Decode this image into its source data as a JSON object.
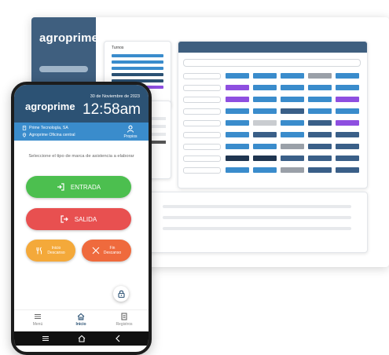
{
  "desktop": {
    "logo": "agroprime",
    "turnos_title": "Turnos",
    "turnos_lines": [
      "#3a8ccc",
      "#3a8ccc",
      "#3a8ccc",
      "#2c5274",
      "#2c5274",
      "#8e4fe0"
    ],
    "grid_rows": [
      [
        "#3a8ccc",
        "#3a8ccc",
        "#3a8ccc",
        "#9aa0a8",
        "#3a8ccc"
      ],
      [
        "#8e4fe0",
        "#3a8ccc",
        "#3a8ccc",
        "#3a8ccc",
        "#3a8ccc"
      ],
      [
        "#8e4fe0",
        "#3a8ccc",
        "#3a8ccc",
        "#3a8ccc",
        "#8e4fe0"
      ],
      [
        "#3a8ccc",
        "#3a8ccc",
        "#3a5f88",
        "#3a8ccc",
        "#3a8ccc"
      ],
      [
        "#3a8ccc",
        "#c9ccd0",
        "#3a8ccc",
        "#3a5f88",
        "#8e4fe0"
      ],
      [
        "#3a8ccc",
        "#3a5f88",
        "#3a8ccc",
        "#3a5f88",
        "#3a5f88"
      ],
      [
        "#3a8ccc",
        "#3a8ccc",
        "#9aa0a8",
        "#3a5f88",
        "#3a5f88"
      ],
      [
        "#1f3550",
        "#1f3550",
        "#3a5f88",
        "#3a5f88",
        "#3a5f88"
      ],
      [
        "#3a8ccc",
        "#3a8ccc",
        "#9aa0a8",
        "#3a5f88",
        "#3a5f88"
      ]
    ]
  },
  "phone": {
    "logo": "agroprime",
    "date": "30 de Noviembre de 2023",
    "time": "12:58am",
    "company": "Prime Tecnología, SA",
    "office": "Agroprime Oficina central",
    "propios_label": "Propios",
    "prompt": "Seleccione el tipo de marca de asistencia a elaborar",
    "entrada_label": "ENTRADA",
    "salida_label": "SALIDA",
    "inicio_label_1": "Inicio",
    "inicio_label_2": "Descanso",
    "fin_label_1": "Fin",
    "fin_label_2": "Descanso",
    "tabs": {
      "menu": "Menú",
      "inicio": "Inicio",
      "registros": "Registros"
    }
  },
  "colors": {
    "brand_dark": "#2c5274",
    "brand_light": "#3a8ccc",
    "entrada": "#4cbf4f",
    "salida": "#e85050",
    "inicio_descanso": "#f4a93a",
    "fin_descanso": "#ef6a3d"
  }
}
